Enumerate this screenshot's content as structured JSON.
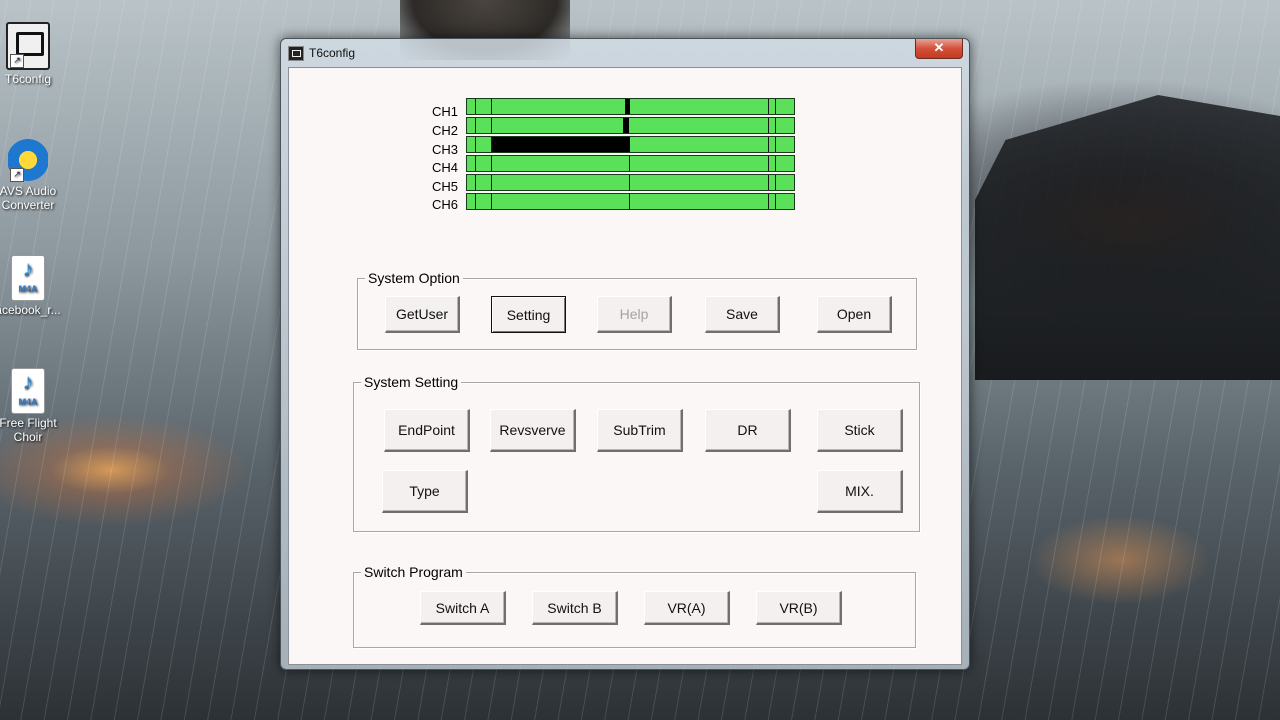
{
  "desktop": {
    "icons": [
      {
        "label": "T6config"
      },
      {
        "label": "AVS Audio Converter"
      },
      {
        "label": "acebook_r...",
        "badge": "M4A"
      },
      {
        "label": "Free Flight Choir",
        "badge": "M4A"
      }
    ]
  },
  "window": {
    "title": "T6config",
    "close_label": "✕"
  },
  "channels": {
    "labels": [
      "CH1",
      "CH2",
      "CH3",
      "CH4",
      "CH5",
      "CH6"
    ],
    "bar_color": "#5be05a"
  },
  "system_option": {
    "legend": "System Option",
    "buttons": [
      "GetUser",
      "Setting",
      "Help",
      "Save",
      "Open"
    ]
  },
  "system_setting": {
    "legend": "System Setting",
    "buttons": [
      "EndPoint",
      "Revsverve",
      "SubTrim",
      "DR",
      "Stick",
      "Type",
      "MIX."
    ]
  },
  "switch_program": {
    "legend": "Switch Program",
    "buttons": [
      "Switch A",
      "Switch B",
      "VR(A)",
      "VR(B)"
    ]
  }
}
